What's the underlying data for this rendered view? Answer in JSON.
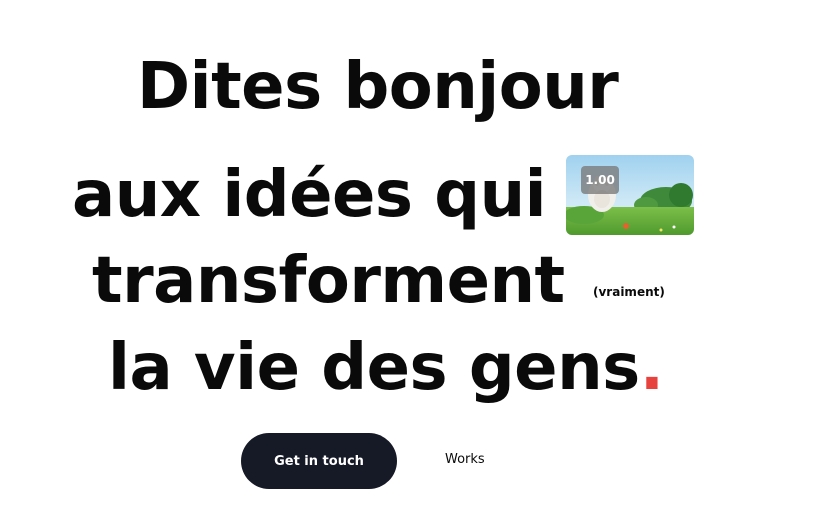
{
  "hero": {
    "line1": "Dites bonjour",
    "line2": "aux idées qui",
    "line3": "transforment",
    "line4": "la vie des gens",
    "period": ".",
    "aside": "(vraiment)"
  },
  "video": {
    "speed_label": "1.00"
  },
  "actions": {
    "primary_label": "Get in touch",
    "secondary_label": "Works"
  },
  "colors": {
    "text": "#0a0a0a",
    "accent": "#e8423f",
    "button_bg": "#161a27",
    "button_text": "#ffffff"
  }
}
